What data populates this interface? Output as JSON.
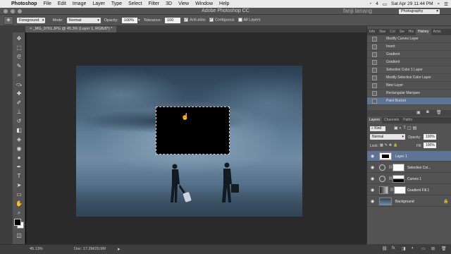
{
  "menubar": {
    "apple": "",
    "app_name": "Photoshop",
    "items": [
      "File",
      "Edit",
      "Image",
      "Layer",
      "Type",
      "Select",
      "Filter",
      "3D",
      "View",
      "Window",
      "Help"
    ],
    "battery": "4",
    "clock": "Sat Apr 29  11:44 PM"
  },
  "window": {
    "title": "Adobe Photoshop CC",
    "watermark": "fanji lanang",
    "workspace": "Photography"
  },
  "options": {
    "fill_source": "Foreground",
    "mode_label": "Mode:",
    "mode_value": "Normal",
    "opacity_label": "Opacity:",
    "opacity_value": "100%",
    "tolerance_label": "Tolerance:",
    "tolerance_value": "100",
    "anti_alias": "Anti-alias",
    "contiguous": "Contiguous",
    "all_layers": "All Layers"
  },
  "document": {
    "tab": "_MG_9761.JPG @ 45.3% (Layer 1, RGB/8*) *"
  },
  "status": {
    "zoom": "45.13%",
    "doc": "Doc: 17.2M/20.9M"
  },
  "history": {
    "tabs": [
      "Info",
      "Nav",
      "Col",
      "Sw",
      "His",
      "History",
      "Actio"
    ],
    "items": [
      "Modify Curves Layer",
      "Invert",
      "Gradient",
      "Gradient",
      "Selective Color 1 Layer",
      "Modify Selective Color Layer",
      "New Layer",
      "Rectangular Marquee",
      "Paint Bucket"
    ],
    "selected_index": 8
  },
  "layers": {
    "tabs": [
      "Layers",
      "Channels",
      "Paths"
    ],
    "kind": "Kind",
    "blend": "Normal",
    "opacity_label": "Opacity:",
    "opacity_value": "100%",
    "lock_label": "Lock:",
    "fill_label": "Fill:",
    "fill_value": "100%",
    "rows": [
      {
        "name": "Layer 1"
      },
      {
        "name": "Selective Col..."
      },
      {
        "name": "Curves 1"
      },
      {
        "name": "Gradient Fill 1"
      },
      {
        "name": "Background"
      }
    ],
    "selected_index": 0
  }
}
